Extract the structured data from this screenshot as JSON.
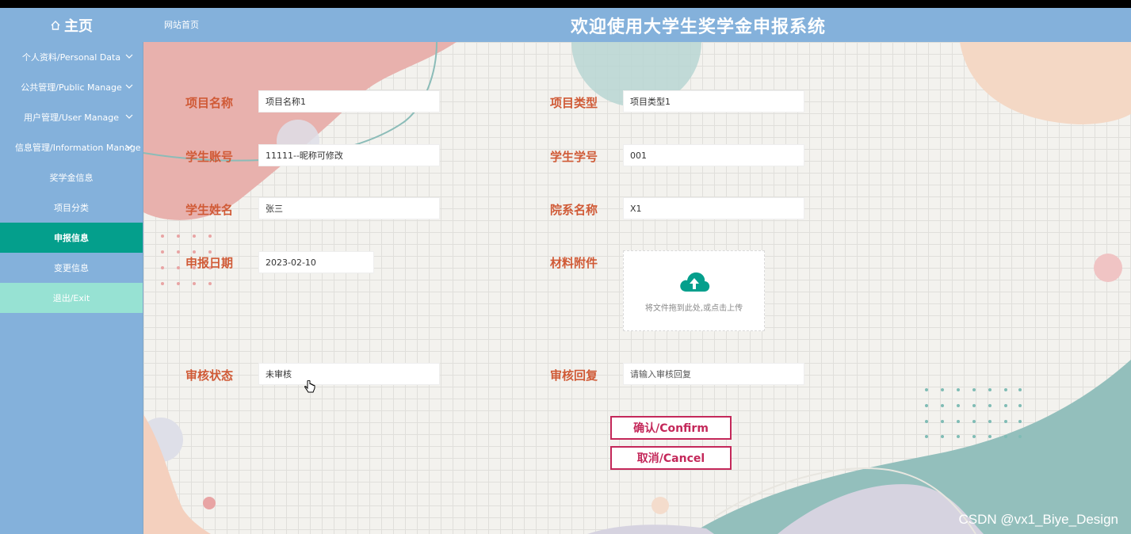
{
  "header": {
    "home_label": "主页",
    "site_home": "网站首页",
    "title": "欢迎使用大学生奖学金申报系统"
  },
  "sidebar": {
    "items": [
      {
        "label": "个人资料/Personal Data",
        "icon": "chevron-down-icon"
      },
      {
        "label": "公共管理/Public Manage",
        "icon": "chevron-down-icon"
      },
      {
        "label": "用户管理/User Manage",
        "icon": "chevron-down-icon"
      },
      {
        "label": "信息管理/Information Manage",
        "icon": "chevron-down-icon"
      },
      {
        "label": "奖学金信息"
      },
      {
        "label": "项目分类"
      },
      {
        "label": "申报信息",
        "active": true
      },
      {
        "label": "变更信息"
      },
      {
        "label": "退出/Exit"
      }
    ]
  },
  "form": {
    "project_name": {
      "label": "项目名称",
      "value": "项目名称1"
    },
    "project_type": {
      "label": "项目类型",
      "value": "项目类型1"
    },
    "student_account": {
      "label": "学生账号",
      "value": "11111--昵称可修改"
    },
    "student_id": {
      "label": "学生学号",
      "value": "001"
    },
    "student_name": {
      "label": "学生姓名",
      "value": "张三"
    },
    "department": {
      "label": "院系名称",
      "value": "X1"
    },
    "apply_date": {
      "label": "申报日期",
      "value": "2023-02-10"
    },
    "attachment": {
      "label": "材料附件",
      "upload_text": "将文件拖到此处,或点击上传",
      "icon": "cloud-upload-icon"
    },
    "review_status": {
      "label": "审核状态",
      "value": "未审核"
    },
    "review_reply": {
      "label": "审核回复",
      "placeholder": "请输入审核回复"
    }
  },
  "buttons": {
    "confirm": "确认/Confirm",
    "cancel": "取消/Cancel"
  },
  "watermark": "CSDN @vx1_Biye_Design",
  "colors": {
    "header_bg": "#84b1db",
    "active_item": "#049f8c",
    "exit_item": "#97e2d3",
    "label": "#d05a36",
    "button": "#c4285a"
  }
}
